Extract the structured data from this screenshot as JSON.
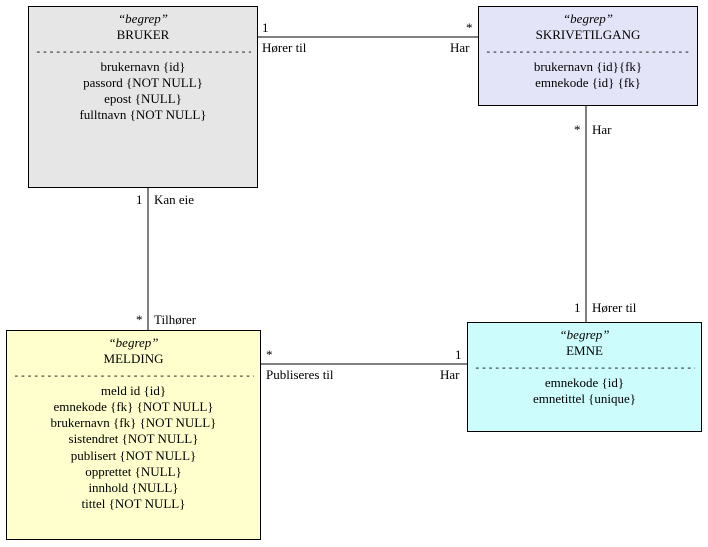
{
  "entities": {
    "bruker": {
      "stereo": "“begrep”",
      "title": "BRUKER",
      "attrs": [
        "brukernavn {id}",
        "passord {NOT NULL}",
        "epost {NULL}",
        "fulltnavn {NOT NULL}"
      ]
    },
    "skrivetilgang": {
      "stereo": "“begrep”",
      "title": "SKRIVETILGANG",
      "attrs": [
        "brukernavn {id}{fk}",
        "emnekode {id} {fk}"
      ]
    },
    "melding": {
      "stereo": "“begrep”",
      "title": "MELDING",
      "attrs": [
        "meld id {id}",
        "emnekode {fk} {NOT NULL}",
        "brukernavn {fk} {NOT NULL}",
        "sistendret {NOT NULL}",
        "publisert {NOT NULL}",
        "opprettet {NULL}",
        "innhold {NULL}",
        "tittel {NOT NULL}"
      ]
    },
    "emne": {
      "stereo": "“begrep”",
      "title": "EMNE",
      "attrs": [
        "emnekode {id}",
        "emnetittel {unique}"
      ]
    }
  },
  "rels": {
    "bruker_skrivetilgang": {
      "left_card": "1",
      "left_role": "Hører til",
      "right_card": "*",
      "right_role": "Har"
    },
    "bruker_melding": {
      "top_card": "1",
      "top_role": "Kan eie",
      "bot_card": "*",
      "bot_role": "Tilhører"
    },
    "skrivetilgang_emne": {
      "top_card": "*",
      "top_role": "Har",
      "bot_card": "1",
      "bot_role": "Hører til"
    },
    "melding_emne": {
      "left_card": "*",
      "left_role": "Publiseres til",
      "right_card": "1",
      "right_role": "Har"
    }
  }
}
